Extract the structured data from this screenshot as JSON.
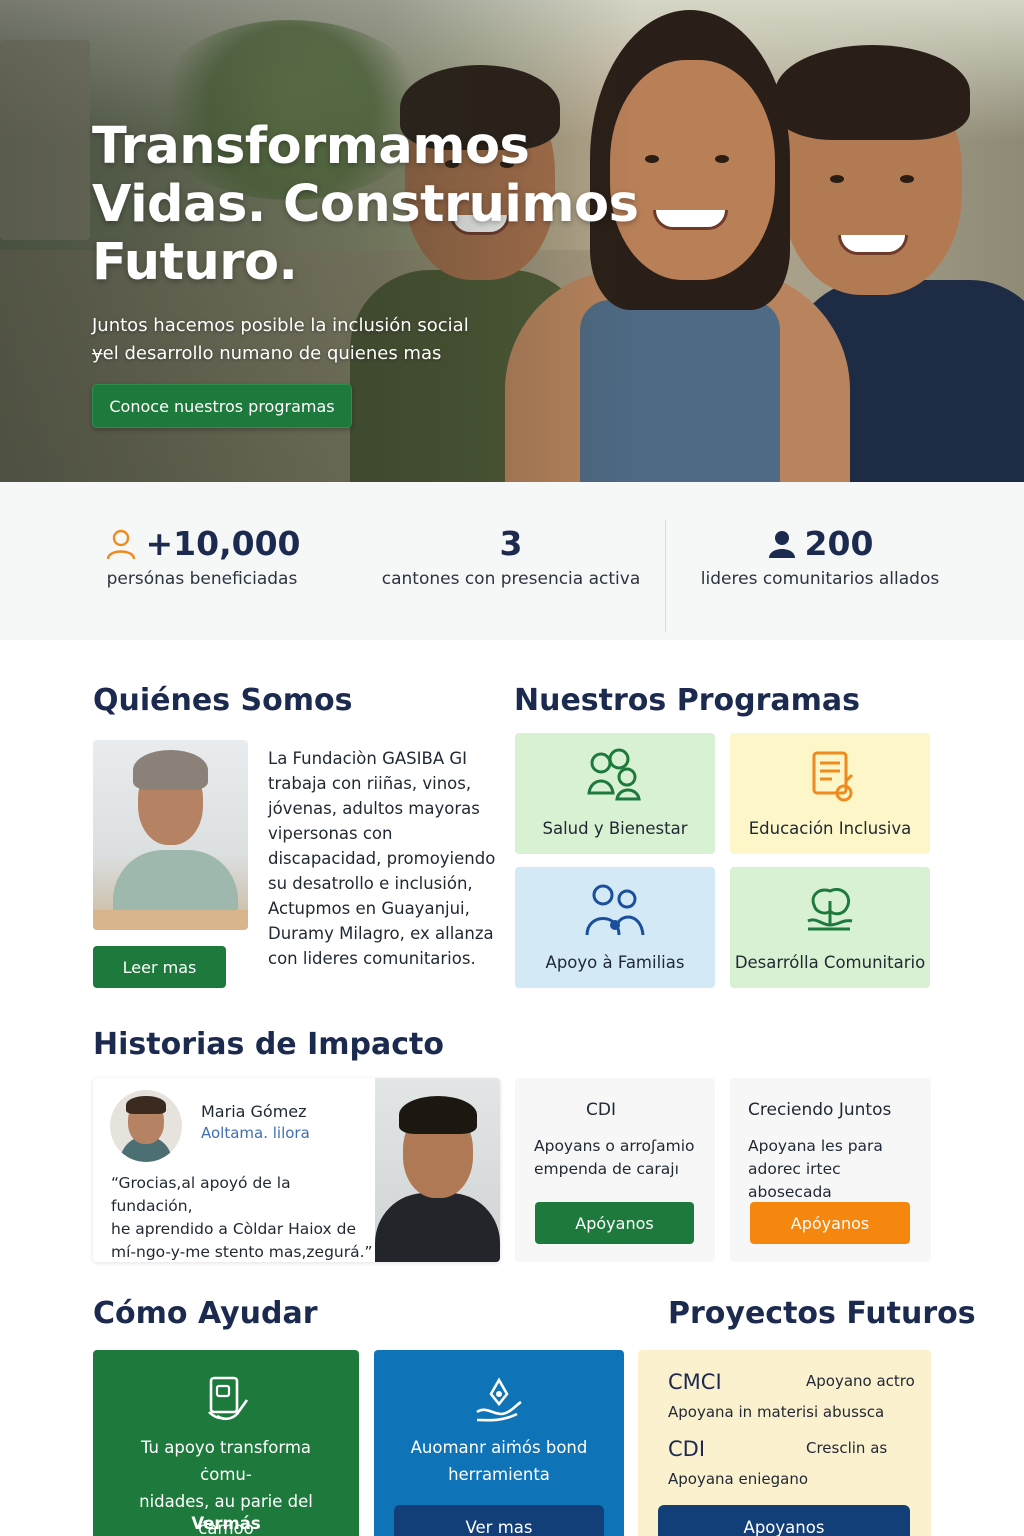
{
  "hero": {
    "title_line1": "Transformamos",
    "title_line2": "Vidas. Construimos",
    "title_line3": "Futuro.",
    "subtitle_line1": "Juntos hacemos posible la inclusión social",
    "subtitle_line2": "ɏel desarrollo numano de quienes mas",
    "cta_label": "Conoce nuestros programas"
  },
  "stats": [
    {
      "value": "+10,000",
      "label": "persónas beneficiadas",
      "icon": "person-outline-icon"
    },
    {
      "value": "3",
      "label": "cantones con presencia activa"
    },
    {
      "value": "200",
      "label": "lideres comunitarios allados",
      "icon": "person-filled-icon"
    }
  ],
  "about": {
    "heading": "Quiénes Somos",
    "text_lines": [
      "La Fundaciòn GASIBA GI",
      "trabaja con riiñas, vinos,",
      "jóvenas, adultos mayoras",
      "vipersonas con",
      "discapacidad, promoyiendo",
      "su desatrollo e inclusión,",
      "Actupmos en Guayanjui,",
      "Duramy Milagro, ex allanza",
      "con lideres comunitarios."
    ],
    "button_label": "Leer mas"
  },
  "programs": {
    "heading": "Nuestros Programas",
    "items": [
      {
        "label": "Salud y Bienestar",
        "icon": "people-group-icon",
        "color": "#d9f1d3"
      },
      {
        "label": "Educación Inclusiva",
        "icon": "document-edit-icon",
        "color": "#fdf6c9"
      },
      {
        "label": "Apoyo à Familias",
        "icon": "family-icon",
        "color": "#d3e9f6"
      },
      {
        "label": "Desarrólla Comunitario",
        "icon": "tree-hand-icon",
        "color": "#d9f1d3"
      }
    ]
  },
  "stories": {
    "heading": "Historias de Impacto",
    "testimonial": {
      "name": "Maria Gómez",
      "role": "Aoltama. lilora",
      "quote_line1": "“Grocias,al apoyó de la fundación,",
      "quote_line2": "he aprendido a Còldar Haiox de",
      "quote_line3": "mí-ngo-y-me stento mas,zegurá.”"
    },
    "cards": [
      {
        "title": "CDI",
        "line1": "Apoyans o arroʃamio",
        "line2": "empenda de carajı",
        "button": "Apóyanos",
        "color": "#1e7a3c"
      },
      {
        "title": "Creciendo Juntos",
        "line1": "Apoyana les para",
        "line2": "adorec irtec abosecada",
        "button": "Apóyanos",
        "color": "#f5870f"
      }
    ]
  },
  "help": {
    "heading": "Cómo Ayudar",
    "cards": [
      {
        "icon": "donation-form-icon",
        "line1": "Tu apoyo transforma ċomu-",
        "line2": "nidades, au parie del ćamoo",
        "button": "Vermás",
        "color": "#1e7a3c"
      },
      {
        "icon": "hand-heart-icon",
        "line1": "Auomanr aiṁós bond",
        "line2": "herramienta",
        "button": "Ver mas",
        "color": "#0f73b8"
      }
    ]
  },
  "future": {
    "heading": "Proyectos Futuros",
    "items": [
      {
        "title": "CMCI",
        "tag": "Apoyano actro",
        "desc": "Apoyana in materisi abussca"
      },
      {
        "title": "CDI",
        "tag": "Cresclin as",
        "desc": "Apoyana eniegano"
      }
    ],
    "button": "Apoyanos"
  }
}
